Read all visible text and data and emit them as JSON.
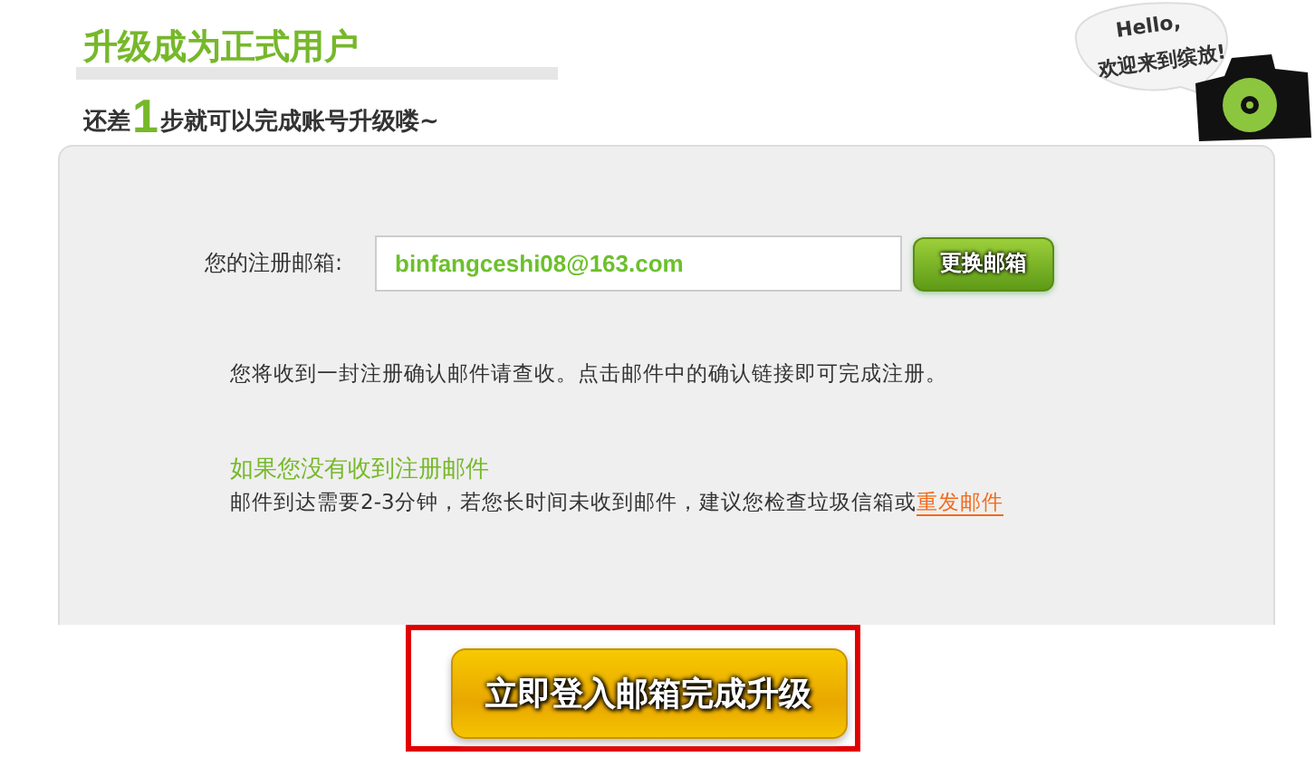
{
  "title": "升级成为正式用户",
  "subtitle": {
    "before": "还差",
    "step": "1",
    "after": "步就可以完成账号升级喽~"
  },
  "mascot": {
    "greeting": "Hello,",
    "welcome": "欢迎来到缤放!"
  },
  "email": {
    "label": "您的注册邮箱:",
    "value": "binfangceshi08@163.com",
    "change_button": "更换邮箱"
  },
  "notice": "您将收到一封注册确认邮件请查收。点击邮件中的确认链接即可完成注册。",
  "help": {
    "heading": "如果您没有收到注册邮件",
    "text": "邮件到达需要2-3分钟，若您长时间未收到邮件，建议您检查垃圾信箱或",
    "link": "重发邮件"
  },
  "submit": {
    "label": "立即登入邮箱完成升级",
    "highlighted": true
  }
}
